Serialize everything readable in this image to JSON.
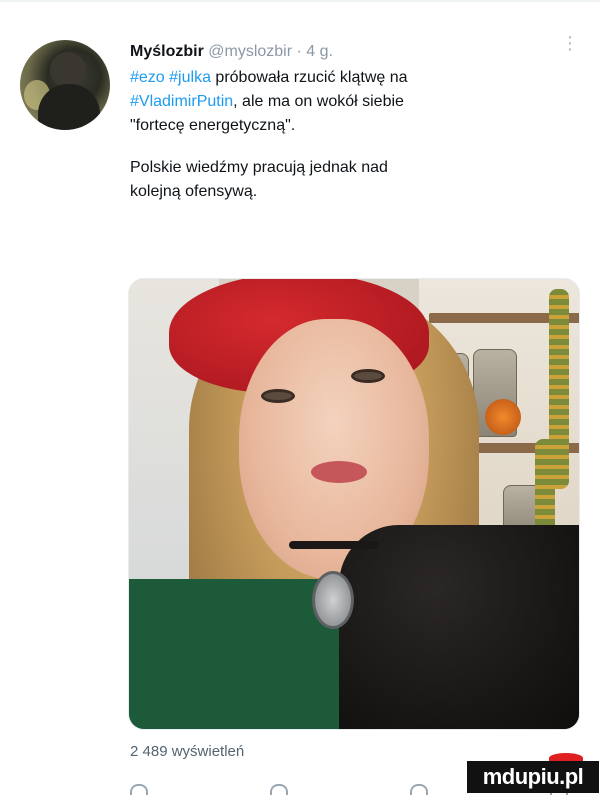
{
  "author": {
    "display_name": "Myślozbir",
    "handle": "@myslozbir",
    "separator": "·",
    "time_ago": "4 g."
  },
  "more_icon": "more-vertical-icon",
  "tweet": {
    "line1_tag1": "#ezo",
    "line1_tag2": "#julka",
    "line1_text": " próbowała rzucić klątwę na",
    "line2_tag": "#VladimirPutin",
    "line2_text": ", ale ma on wokół siebie",
    "line3_text": "\"fortecę energetyczną\".",
    "paragraph2_line1": "Polskie wiedźmy pracują jednak nad",
    "paragraph2_line2": "kolejną ofensywą."
  },
  "views": "2 489 wyświetleń",
  "actions": [
    "reply-icon",
    "retweet-icon",
    "like-icon",
    "share-icon"
  ],
  "colors": {
    "link": "#1d9bf0",
    "muted": "#8b98a5",
    "text": "#0f1419"
  },
  "watermark": {
    "text": "mdupiu.pl"
  }
}
